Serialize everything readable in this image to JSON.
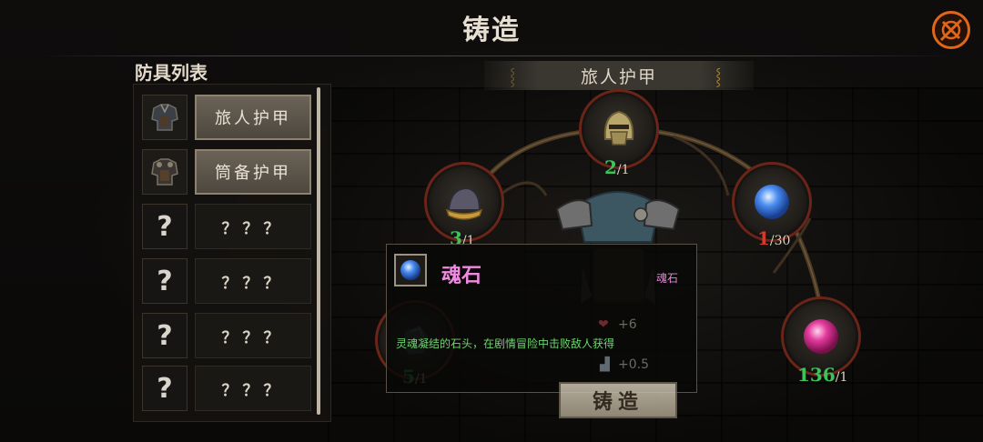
{
  "header": {
    "title": "铸造"
  },
  "armor_list": {
    "title": "防具列表",
    "items": [
      {
        "name": "旅人护甲",
        "thumb": "armor-icon"
      },
      {
        "name": "筒备护甲",
        "thumb": "armor-icon"
      },
      {
        "name": "？？？",
        "thumb": "question-mark-icon"
      },
      {
        "name": "？？？",
        "thumb": "question-mark-icon"
      },
      {
        "name": "？？？",
        "thumb": "question-mark-icon"
      },
      {
        "name": "？？？",
        "thumb": "question-mark-icon"
      }
    ]
  },
  "selected_armor": {
    "name": "旅人护甲"
  },
  "materials": [
    {
      "icon": "helmet-icon",
      "have": "2",
      "need": "/1",
      "status": "enough"
    },
    {
      "icon": "helmet-icon",
      "have": "3",
      "need": "/1",
      "status": "enough"
    },
    {
      "icon": "blue-orb-icon",
      "have": "1",
      "need": "/30",
      "status": "insufficient"
    },
    {
      "icon": "stone-icon",
      "have": "5",
      "need": "/1",
      "status": "enough"
    },
    {
      "icon": "pink-orb-icon",
      "have": "136",
      "need": "/1",
      "status": "enough"
    }
  ],
  "tooltip": {
    "name": "魂石",
    "type": "魂石",
    "description": "灵魂凝结的石头，在剧情冒险中击败敌人获得",
    "stats": [
      "+6",
      "+0.5"
    ]
  },
  "forge_button": {
    "label": "铸造"
  },
  "colors": {
    "enough": "#3ec25a",
    "insufficient": "#d23a2e",
    "accent": "#e0661a",
    "tooltip_name": "#f08ae0"
  }
}
